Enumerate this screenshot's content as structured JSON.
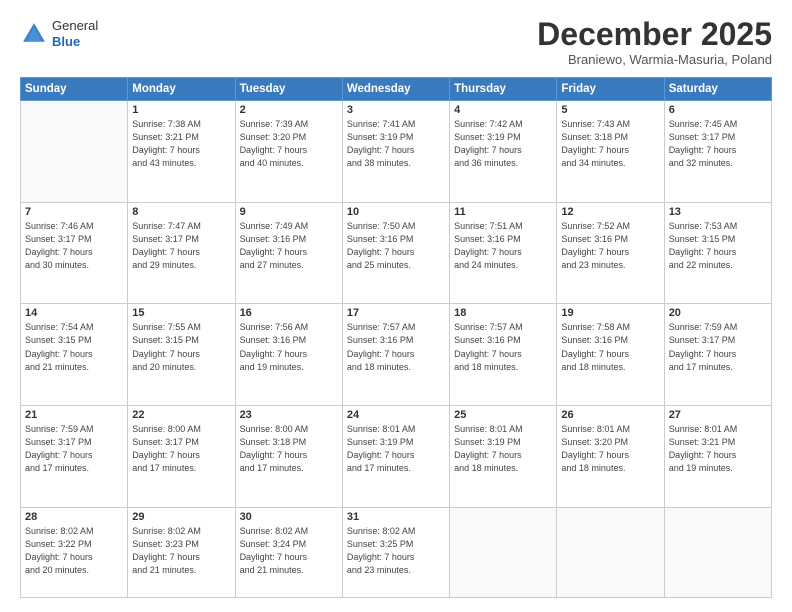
{
  "logo": {
    "general": "General",
    "blue": "Blue"
  },
  "header": {
    "month": "December 2025",
    "location": "Braniewo, Warmia-Masuria, Poland"
  },
  "weekdays": [
    "Sunday",
    "Monday",
    "Tuesday",
    "Wednesday",
    "Thursday",
    "Friday",
    "Saturday"
  ],
  "weeks": [
    [
      {
        "day": "",
        "info": ""
      },
      {
        "day": "1",
        "info": "Sunrise: 7:38 AM\nSunset: 3:21 PM\nDaylight: 7 hours\nand 43 minutes."
      },
      {
        "day": "2",
        "info": "Sunrise: 7:39 AM\nSunset: 3:20 PM\nDaylight: 7 hours\nand 40 minutes."
      },
      {
        "day": "3",
        "info": "Sunrise: 7:41 AM\nSunset: 3:19 PM\nDaylight: 7 hours\nand 38 minutes."
      },
      {
        "day": "4",
        "info": "Sunrise: 7:42 AM\nSunset: 3:19 PM\nDaylight: 7 hours\nand 36 minutes."
      },
      {
        "day": "5",
        "info": "Sunrise: 7:43 AM\nSunset: 3:18 PM\nDaylight: 7 hours\nand 34 minutes."
      },
      {
        "day": "6",
        "info": "Sunrise: 7:45 AM\nSunset: 3:17 PM\nDaylight: 7 hours\nand 32 minutes."
      }
    ],
    [
      {
        "day": "7",
        "info": "Sunrise: 7:46 AM\nSunset: 3:17 PM\nDaylight: 7 hours\nand 30 minutes."
      },
      {
        "day": "8",
        "info": "Sunrise: 7:47 AM\nSunset: 3:17 PM\nDaylight: 7 hours\nand 29 minutes."
      },
      {
        "day": "9",
        "info": "Sunrise: 7:49 AM\nSunset: 3:16 PM\nDaylight: 7 hours\nand 27 minutes."
      },
      {
        "day": "10",
        "info": "Sunrise: 7:50 AM\nSunset: 3:16 PM\nDaylight: 7 hours\nand 25 minutes."
      },
      {
        "day": "11",
        "info": "Sunrise: 7:51 AM\nSunset: 3:16 PM\nDaylight: 7 hours\nand 24 minutes."
      },
      {
        "day": "12",
        "info": "Sunrise: 7:52 AM\nSunset: 3:16 PM\nDaylight: 7 hours\nand 23 minutes."
      },
      {
        "day": "13",
        "info": "Sunrise: 7:53 AM\nSunset: 3:15 PM\nDaylight: 7 hours\nand 22 minutes."
      }
    ],
    [
      {
        "day": "14",
        "info": "Sunrise: 7:54 AM\nSunset: 3:15 PM\nDaylight: 7 hours\nand 21 minutes."
      },
      {
        "day": "15",
        "info": "Sunrise: 7:55 AM\nSunset: 3:15 PM\nDaylight: 7 hours\nand 20 minutes."
      },
      {
        "day": "16",
        "info": "Sunrise: 7:56 AM\nSunset: 3:16 PM\nDaylight: 7 hours\nand 19 minutes."
      },
      {
        "day": "17",
        "info": "Sunrise: 7:57 AM\nSunset: 3:16 PM\nDaylight: 7 hours\nand 18 minutes."
      },
      {
        "day": "18",
        "info": "Sunrise: 7:57 AM\nSunset: 3:16 PM\nDaylight: 7 hours\nand 18 minutes."
      },
      {
        "day": "19",
        "info": "Sunrise: 7:58 AM\nSunset: 3:16 PM\nDaylight: 7 hours\nand 18 minutes."
      },
      {
        "day": "20",
        "info": "Sunrise: 7:59 AM\nSunset: 3:17 PM\nDaylight: 7 hours\nand 17 minutes."
      }
    ],
    [
      {
        "day": "21",
        "info": "Sunrise: 7:59 AM\nSunset: 3:17 PM\nDaylight: 7 hours\nand 17 minutes."
      },
      {
        "day": "22",
        "info": "Sunrise: 8:00 AM\nSunset: 3:17 PM\nDaylight: 7 hours\nand 17 minutes."
      },
      {
        "day": "23",
        "info": "Sunrise: 8:00 AM\nSunset: 3:18 PM\nDaylight: 7 hours\nand 17 minutes."
      },
      {
        "day": "24",
        "info": "Sunrise: 8:01 AM\nSunset: 3:19 PM\nDaylight: 7 hours\nand 17 minutes."
      },
      {
        "day": "25",
        "info": "Sunrise: 8:01 AM\nSunset: 3:19 PM\nDaylight: 7 hours\nand 18 minutes."
      },
      {
        "day": "26",
        "info": "Sunrise: 8:01 AM\nSunset: 3:20 PM\nDaylight: 7 hours\nand 18 minutes."
      },
      {
        "day": "27",
        "info": "Sunrise: 8:01 AM\nSunset: 3:21 PM\nDaylight: 7 hours\nand 19 minutes."
      }
    ],
    [
      {
        "day": "28",
        "info": "Sunrise: 8:02 AM\nSunset: 3:22 PM\nDaylight: 7 hours\nand 20 minutes."
      },
      {
        "day": "29",
        "info": "Sunrise: 8:02 AM\nSunset: 3:23 PM\nDaylight: 7 hours\nand 21 minutes."
      },
      {
        "day": "30",
        "info": "Sunrise: 8:02 AM\nSunset: 3:24 PM\nDaylight: 7 hours\nand 21 minutes."
      },
      {
        "day": "31",
        "info": "Sunrise: 8:02 AM\nSunset: 3:25 PM\nDaylight: 7 hours\nand 23 minutes."
      },
      {
        "day": "",
        "info": ""
      },
      {
        "day": "",
        "info": ""
      },
      {
        "day": "",
        "info": ""
      }
    ]
  ]
}
